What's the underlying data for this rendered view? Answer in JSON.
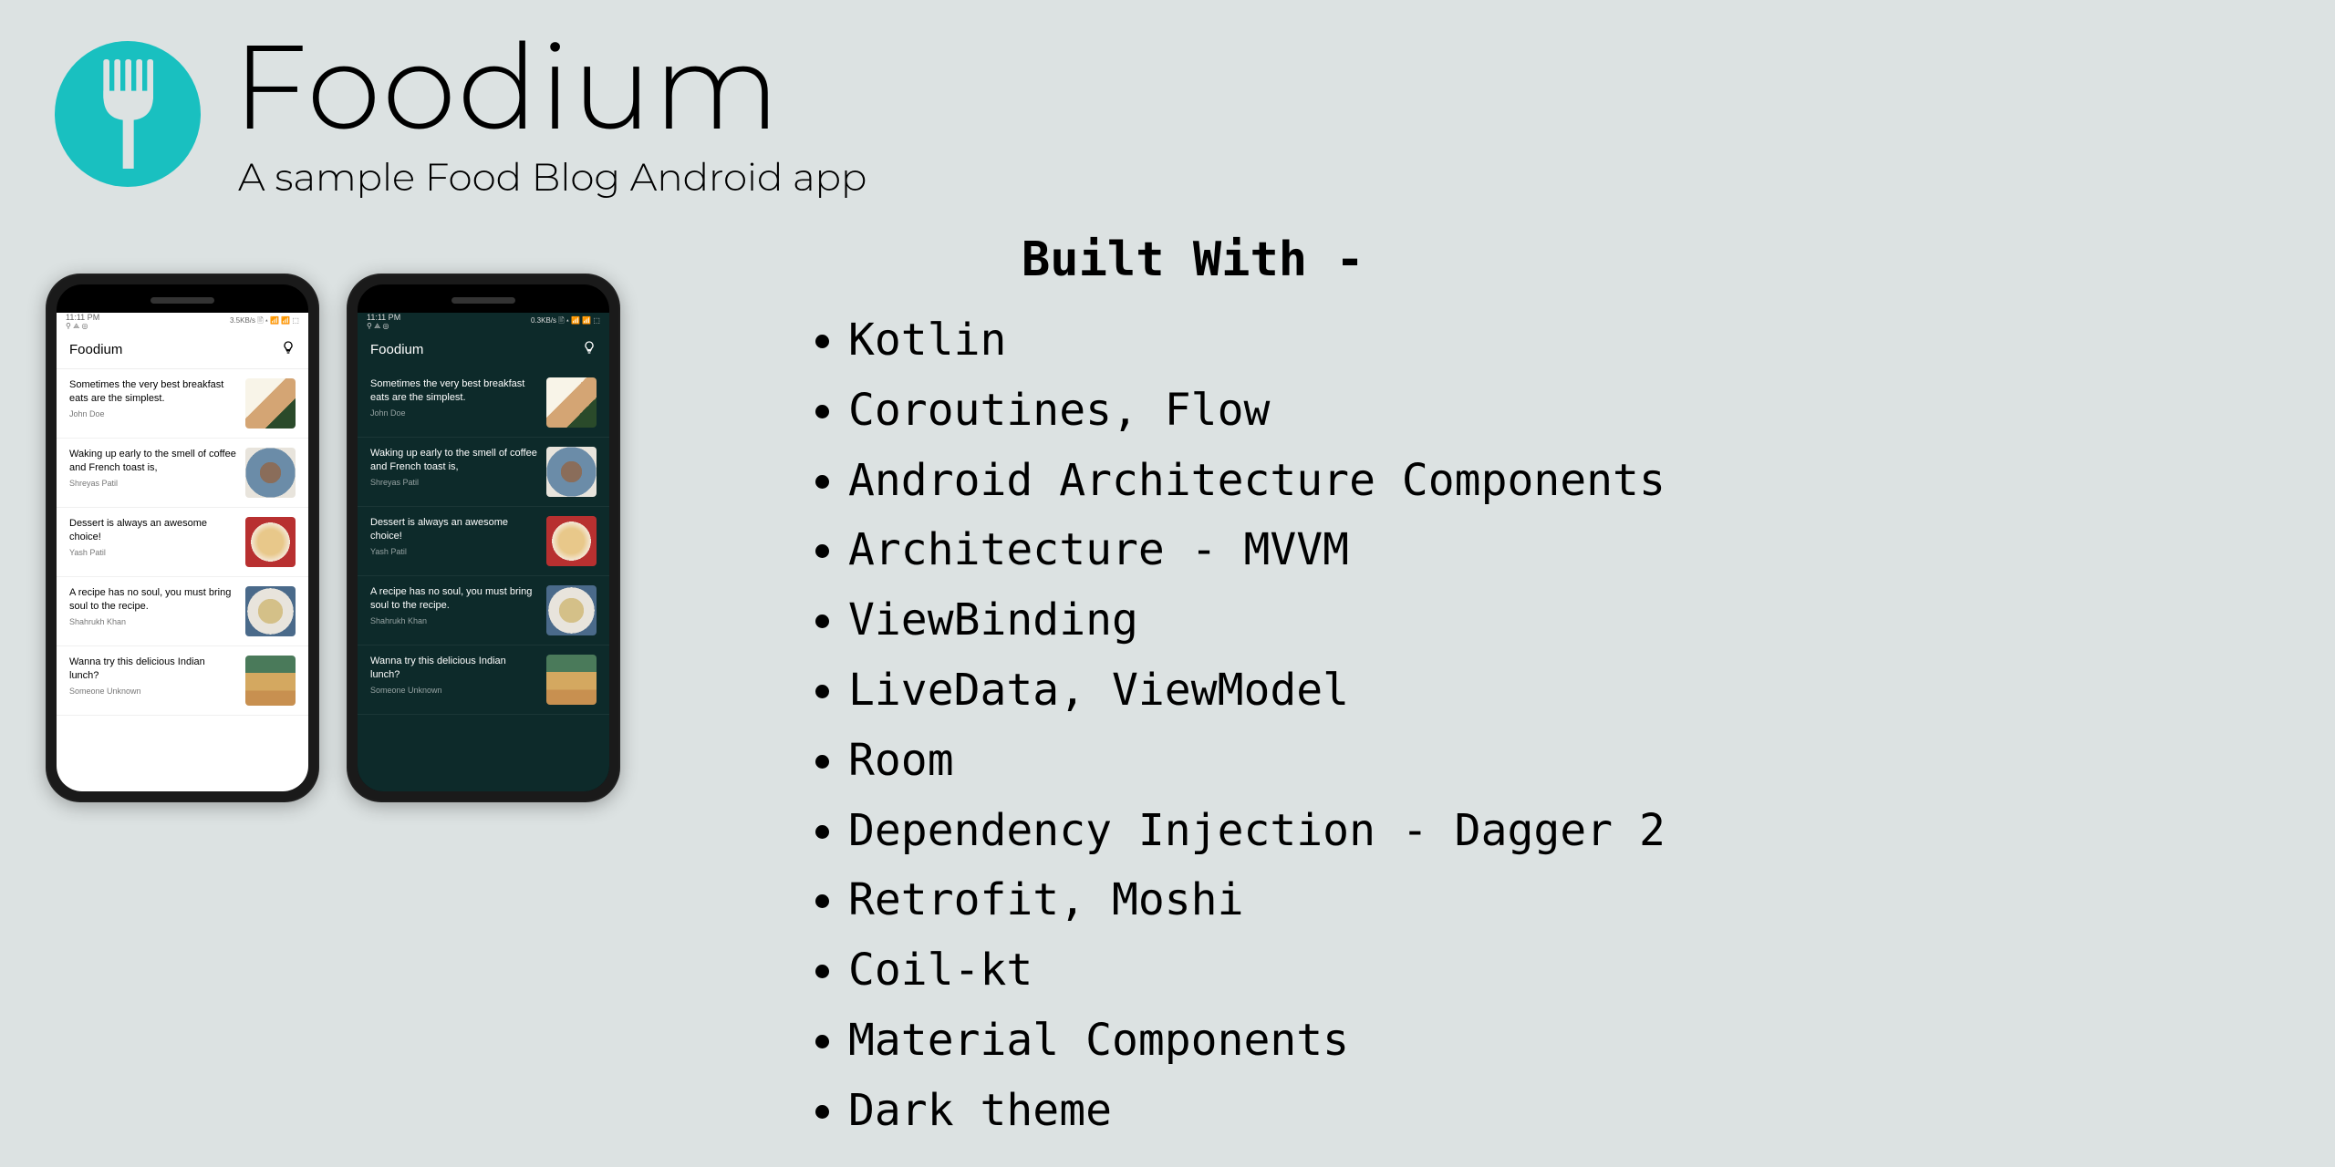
{
  "header": {
    "title": "Foodium",
    "subtitle": "A sample Food Blog Android app"
  },
  "status": {
    "time": "11:11 PM",
    "left_icons": "⚲ ⟁ ◎",
    "right_light": "3.5KB/s 🖹 ▴ 📶 📶 ⬚",
    "right_dark": "0.3KB/s 🖹 ▴ 📶 📶 ⬚"
  },
  "app_bar": {
    "title": "Foodium",
    "bulb_icon": "light-bulb-icon"
  },
  "posts": [
    {
      "title": "Sometimes the very best breakfast eats are the simplest.",
      "author": "John Doe"
    },
    {
      "title": "Waking up early to the smell of coffee and French toast is,",
      "author": "Shreyas Patil"
    },
    {
      "title": "Dessert is always an awesome choice!",
      "author": "Yash Patil"
    },
    {
      "title": "A recipe has no soul, you must bring soul to the recipe.",
      "author": "Shahrukh Khan"
    },
    {
      "title": "Wanna try this delicious Indian lunch?",
      "author": "Someone Unknown"
    }
  ],
  "built_with": {
    "heading": "Built With -",
    "items": [
      "Kotlin",
      "Coroutines, Flow",
      "Android Architecture Components",
      "Architecture - MVVM",
      "ViewBinding",
      "LiveData, ViewModel",
      "Room",
      "Dependency Injection - Dagger 2",
      "Retrofit, Moshi",
      "Coil-kt",
      "Material Components",
      "Dark theme"
    ]
  }
}
